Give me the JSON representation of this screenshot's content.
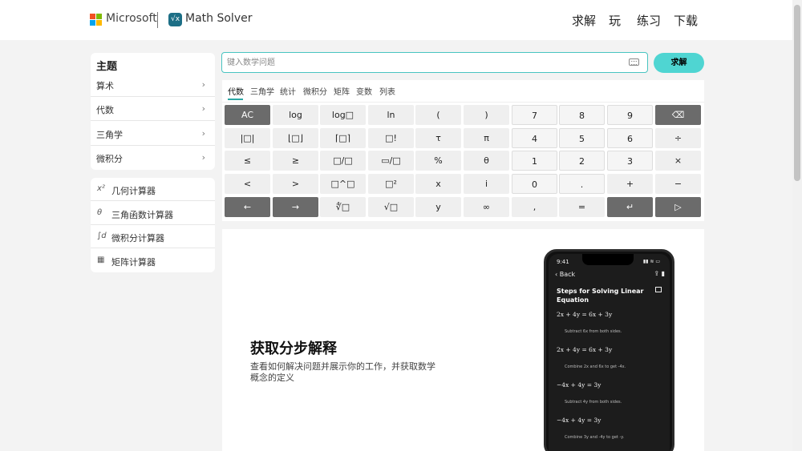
{
  "header": {
    "brand": "Microsoft",
    "app_icon": "√x",
    "app_name": "Math Solver",
    "nav": [
      "求解",
      "玩",
      "练习",
      "下载"
    ],
    "colors": {
      "ms_red": "#f25022",
      "ms_green": "#7fba00",
      "ms_blue": "#00a4ef",
      "ms_yellow": "#ffb900"
    }
  },
  "sidebar": {
    "topics_title": "主题",
    "topics": [
      {
        "label": "算术",
        "icon": "chevron-right"
      },
      {
        "label": "代数",
        "icon": "chevron-right"
      },
      {
        "label": "三角学",
        "icon": "chevron-right"
      },
      {
        "label": "微积分",
        "icon": "chevron-right"
      }
    ],
    "calculators": [
      {
        "icon_text": "x²",
        "label": "几何计算器"
      },
      {
        "icon_text": "θ",
        "label": "三角函数计算器"
      },
      {
        "icon_text": "∫d",
        "label": "微积分计算器"
      },
      {
        "icon_text": "▦",
        "label": "矩阵计算器"
      }
    ]
  },
  "search": {
    "placeholder": "键入数学问题",
    "value": "",
    "solve_label": "求解",
    "accent": "#4fd5d2"
  },
  "keypad": {
    "tabs": [
      "代数",
      "三角学",
      "统计",
      "微积分",
      "矩阵",
      "变数",
      "列表"
    ],
    "active_tab": "代数",
    "rows": [
      [
        "AC",
        "log",
        "log□",
        "ln",
        "(",
        ")",
        "7",
        "8",
        "9",
        "⌫"
      ],
      [
        "|□|",
        "⌊□⌋",
        "⌈□⌉",
        "□!",
        "τ",
        "π",
        "4",
        "5",
        "6",
        "÷"
      ],
      [
        "≤",
        "≥",
        "□/□",
        "▭/□",
        "%",
        "θ",
        "1",
        "2",
        "3",
        "×"
      ],
      [
        "<",
        ">",
        "□^□",
        "□²",
        "x",
        "i",
        "0",
        ".",
        "+",
        "−"
      ],
      [
        "←",
        "→",
        "∜□",
        "√□",
        "y",
        "∞",
        ",",
        "=",
        "↵",
        "▷"
      ]
    ]
  },
  "promo": {
    "title": "获取分步解释",
    "description": "查看如何解决问题并展示你的工作，并获取数学概念的定义"
  },
  "phone": {
    "time": "9:41",
    "status": "▮▮ ≋ ▭",
    "back": "‹ Back",
    "icons": "⇪ ▮",
    "heading": "Steps for Solving Linear Equation",
    "steps": [
      {
        "eq": "2x + 4y = 6x + 3y",
        "note": "Subtract 6x from both sides."
      },
      {
        "eq": "2x + 4y = 6x + 3y",
        "note": "Combine 2x and 6x to get -4x."
      },
      {
        "eq": "−4x + 4y = 3y",
        "note": "Subtract 4y from both sides."
      },
      {
        "eq": "−4x + 4y = 3y",
        "note": "Combine 3y and -4y to get -y."
      }
    ]
  }
}
